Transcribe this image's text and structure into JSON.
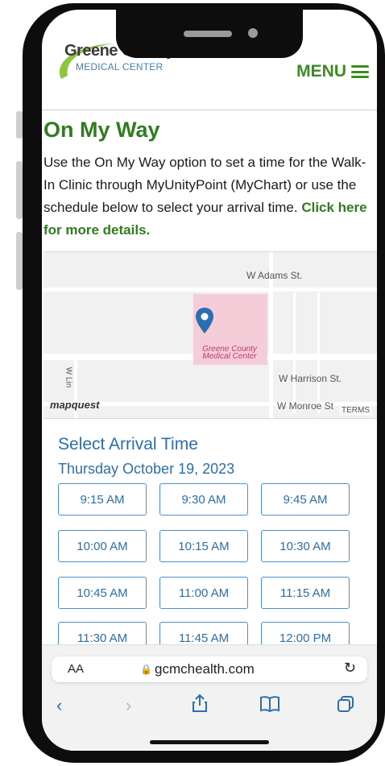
{
  "header": {
    "logo_main": "Greene County",
    "logo_sub": "MEDICAL CENTER",
    "menu_label": "MENU"
  },
  "page": {
    "title": "On My Way",
    "intro_text": "Use the On My Way option to set a time for the Walk-In Clinic through MyUnityPoint (MyChart) or use the schedule below to select your arrival time. ",
    "intro_link": "Click here for more details."
  },
  "map": {
    "street_adams": "W Adams St.",
    "street_harrison": "W Harrison St.",
    "street_monroe": "W Monroe St",
    "street_lin": "W Lin",
    "hospital_label": "Greene County Medical Center",
    "provider": "mapquest",
    "terms": "TERMS",
    "colors": {
      "hospital_area": "#f5cdd8",
      "pin": "#2a6fb0"
    }
  },
  "schedule": {
    "heading": "Select Arrival Time",
    "date": "Thursday October 19, 2023",
    "times": [
      "9:15 AM",
      "9:30 AM",
      "9:45 AM",
      "10:00 AM",
      "10:15 AM",
      "10:30 AM",
      "10:45 AM",
      "11:00 AM",
      "11:15 AM",
      "11:30 AM",
      "11:45 AM",
      "12:00 PM"
    ]
  },
  "browser": {
    "text_size": "AA",
    "url": "gcmchealth.com",
    "icons": [
      "back-icon",
      "forward-icon",
      "share-icon",
      "bookmarks-icon",
      "tabs-icon"
    ]
  },
  "colors": {
    "brand_green": "#2f7d1e",
    "brand_blue": "#2a6fb0"
  }
}
